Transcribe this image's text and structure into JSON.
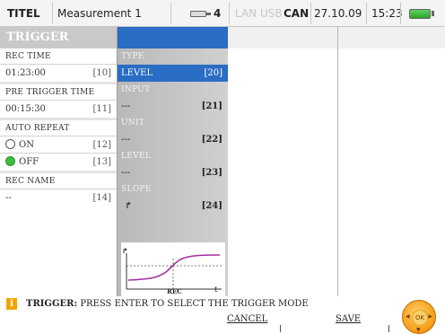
{
  "topbar": {
    "title": "TITEL",
    "measurement": "Measurement 1",
    "probe_count": "4",
    "lan": "LAN",
    "usb": "USB",
    "can": "CAN",
    "date": "27.10.09",
    "time": "15:23"
  },
  "left_panel": {
    "title": "TRIGGER",
    "rec_time": {
      "label": "REC TIME",
      "value": "01:23:00",
      "num": "[10]"
    },
    "pre_trigger_time": {
      "label": "PRE TRIGGER TIME",
      "value": "00:15:30",
      "num": "[11]"
    },
    "auto_repeat": {
      "label": "AUTO REPEAT",
      "on": {
        "label": "ON",
        "num": "[12]"
      },
      "off": {
        "label": "OFF",
        "num": "[13]"
      },
      "selected": "OFF"
    },
    "rec_name": {
      "label": "REC NAME",
      "value": "--",
      "num": "[14]"
    }
  },
  "middle_panel": {
    "type": {
      "label": "TYPE",
      "value": "LEVEL",
      "num": "[20]"
    },
    "input": {
      "label": "INPUT",
      "value": "---",
      "num": "[21]"
    },
    "unit": {
      "label": "UNIT",
      "value": "---",
      "num": "[22]"
    },
    "level": {
      "label": "LEVEL",
      "value": "---",
      "num": "[23]"
    },
    "slope": {
      "label": "SLOPE",
      "value": "↱",
      "num": "[24]"
    },
    "graph": {
      "rec_label": "REC",
      "t_label": "t",
      "slope_symbol": "↱"
    }
  },
  "info": {
    "icon": "i",
    "heading": "TRIGGER:",
    "message": " PRESS ENTER TO SELECT THE TRIGGER MODE"
  },
  "buttons": {
    "cancel": "CANCEL",
    "save": "SAVE",
    "ok": "OK"
  },
  "colors": {
    "accent_blue": "#2a6dc4",
    "on_green": "#3dbb3d",
    "info_orange": "#f1a500",
    "curve_purple": "#a0309b"
  }
}
